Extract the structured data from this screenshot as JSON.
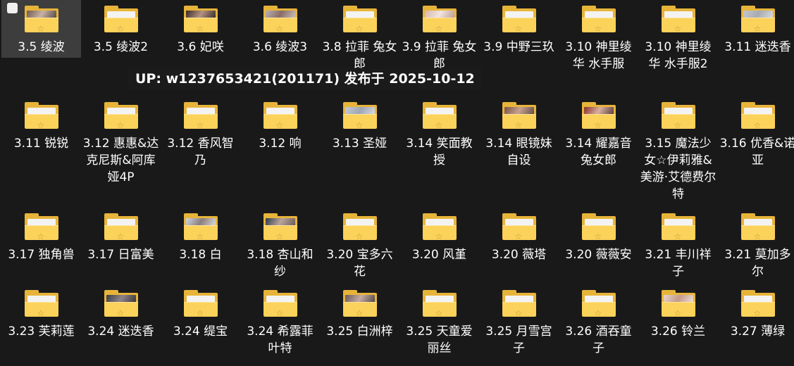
{
  "folders": [
    {
      "label": "3.5 绫波",
      "selected": true,
      "checked": false,
      "thumb": true,
      "thumb_colors": [
        "#6e5a50",
        "#c9b2a6",
        "#3a3230"
      ]
    },
    {
      "label": "3.5 绫波2",
      "thumb": false
    },
    {
      "label": "3.6 妃咲",
      "thumb": true,
      "thumb_colors": [
        "#3b2a24",
        "#b49282",
        "#1e1816"
      ]
    },
    {
      "label": "3.6 绫波3",
      "thumb": true,
      "thumb_colors": [
        "#b8b4b6",
        "#8a6c64",
        "#d8d2d0"
      ]
    },
    {
      "label": "3.8 拉菲 兔女郎",
      "thumb": false
    },
    {
      "label": "3.9 拉菲 兔女郎",
      "thumb": true,
      "thumb_colors": [
        "#d8b4a8",
        "#f0e4de",
        "#b08e84"
      ]
    },
    {
      "label": "3.9 中野三玖",
      "thumb": false
    },
    {
      "label": "3.10 神里绫华 水手服",
      "thumb": false
    },
    {
      "label": "3.10 神里绫华 水手服2",
      "thumb": false
    },
    {
      "label": "3.11 迷迭香",
      "thumb": true,
      "thumb_colors": [
        "#c4c8cc",
        "#a8acb2",
        "#e2e4e6"
      ]
    },
    {
      "label": "3.11 锐锐",
      "thumb": false
    },
    {
      "label": "3.12 惠惠&达克尼斯&阿库娅4P",
      "thumb": false
    },
    {
      "label": "3.12 香风智乃",
      "thumb": false
    },
    {
      "label": "3.12 响",
      "thumb": false
    },
    {
      "label": "3.13 圣娅",
      "thumb": true,
      "thumb_colors": [
        "#c6ccd6",
        "#9ea6b4",
        "#e4e6ea"
      ]
    },
    {
      "label": "3.14 笑面教授",
      "thumb": false
    },
    {
      "label": "3.14 眼镜妹 自设",
      "thumb": true,
      "thumb_colors": [
        "#7a5448",
        "#c8a090",
        "#4a3a34"
      ]
    },
    {
      "label": "3.14 耀嘉音 兔女郎",
      "thumb": true,
      "thumb_colors": [
        "#8a2e2a",
        "#d8b0a0",
        "#3e2422"
      ]
    },
    {
      "label": "3.15 魔法少女☆伊莉雅&美游·艾德费尔特",
      "thumb": false
    },
    {
      "label": "3.16 优香&诺亚",
      "thumb": false
    },
    {
      "label": "3.17 独角兽",
      "thumb": false
    },
    {
      "label": "3.17 日富美",
      "thumb": false
    },
    {
      "label": "3.18 白",
      "thumb": true,
      "thumb_colors": [
        "#d0d6e0",
        "#8a7e7c",
        "#eef0f2"
      ]
    },
    {
      "label": "3.18 杏山和纱",
      "thumb": true,
      "thumb_colors": [
        "#2e3a4e",
        "#b8a49a",
        "#5a4a48"
      ]
    },
    {
      "label": "3.20 宝多六花",
      "thumb": false
    },
    {
      "label": "3.20 风堇",
      "thumb": false
    },
    {
      "label": "3.20 薇塔",
      "thumb": false
    },
    {
      "label": "3.20 薇薇安",
      "thumb": false
    },
    {
      "label": "3.21 丰川祥子",
      "thumb": false
    },
    {
      "label": "3.21 莫加多尔",
      "thumb": false
    },
    {
      "label": "3.23 芙莉莲",
      "thumb": false
    },
    {
      "label": "3.24 迷迭香",
      "thumb": true,
      "thumb_colors": [
        "#3a3c44",
        "#8e8488",
        "#22242a"
      ]
    },
    {
      "label": "3.24 缇宝",
      "thumb": false
    },
    {
      "label": "3.24 希露菲叶特",
      "thumb": false
    },
    {
      "label": "3.25 白洲梓",
      "thumb": true,
      "thumb_colors": [
        "#6a5a5a",
        "#c4aaa2",
        "#3a3232"
      ]
    },
    {
      "label": "3.25 天童爱丽丝",
      "thumb": false
    },
    {
      "label": "3.25 月雪宫子",
      "thumb": false
    },
    {
      "label": "3.26 酒吞童子",
      "thumb": false
    },
    {
      "label": "3.26 铃兰",
      "thumb": true,
      "thumb_colors": [
        "#e8d6cc",
        "#c49a8a",
        "#f4ece6"
      ]
    },
    {
      "label": "3.27 薄绿",
      "thumb": false
    }
  ],
  "tooltip": {
    "text": "UP: w1237653421(201171) 发布于 2025-10-12"
  },
  "colors": {
    "background": "#191919",
    "folder_back": "#e7b43a",
    "folder_front": "#fbd25a",
    "selection": "#3d3d3d"
  },
  "icons": {
    "folder": "folder-icon",
    "checkbox": "checkbox-icon"
  }
}
